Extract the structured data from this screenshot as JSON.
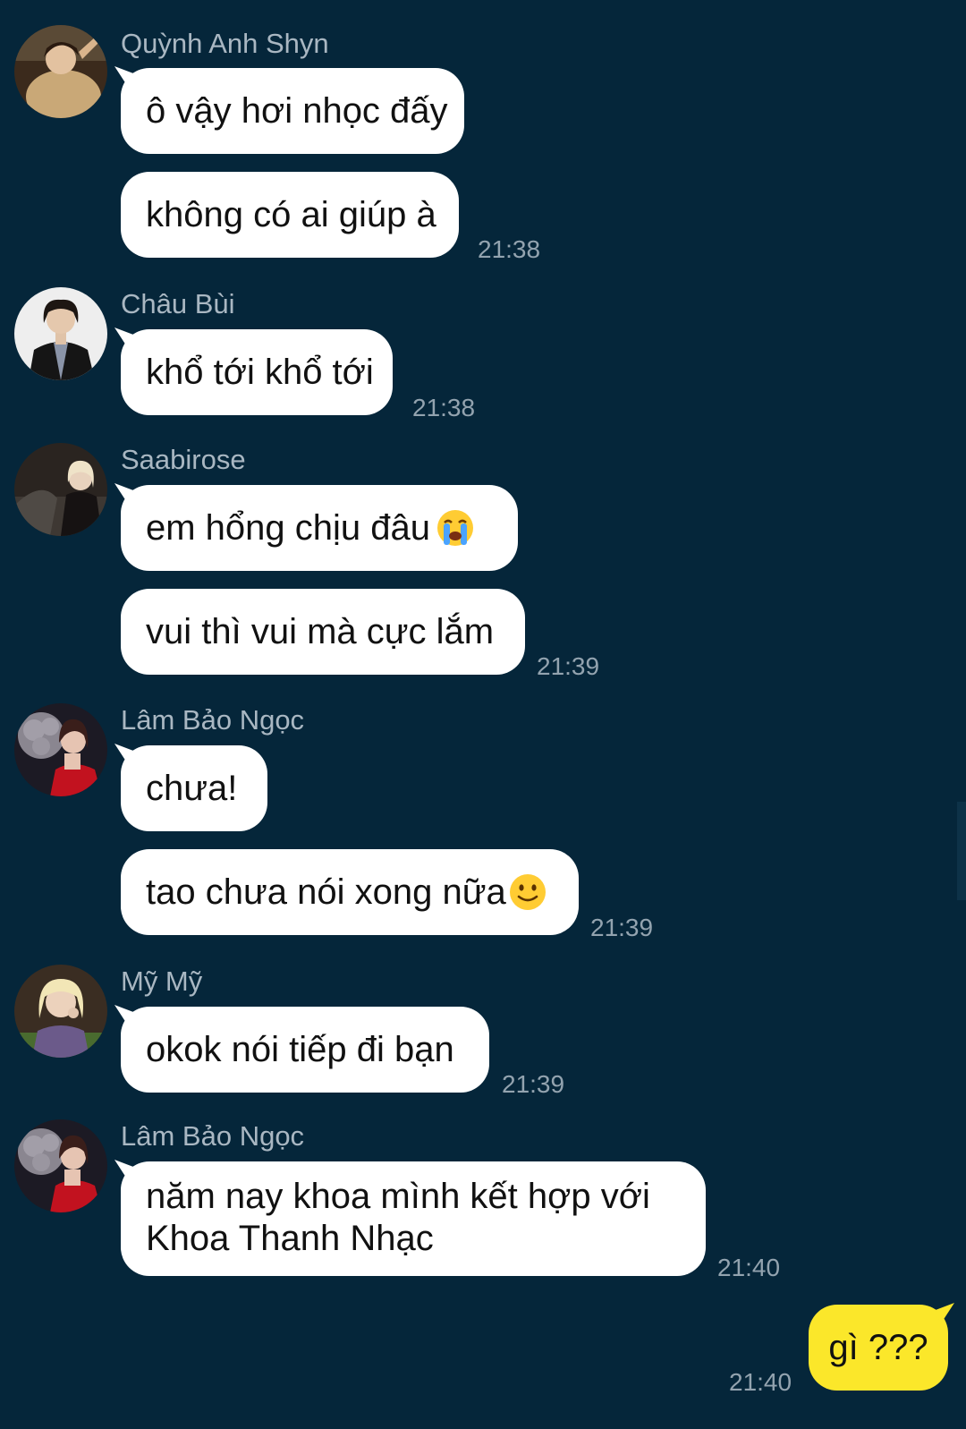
{
  "messages": [
    {
      "sender": "Quỳnh Anh Shyn",
      "avatar_icon": "avatar-quynh-anh-shyn",
      "bubbles": [
        "ô vậy hơi nhọc đấy",
        "không có ai giúp à"
      ],
      "time": "21:38"
    },
    {
      "sender": "Châu Bùi",
      "avatar_icon": "avatar-chau-bui",
      "bubbles": [
        "khổ tới khổ tới"
      ],
      "time": "21:38"
    },
    {
      "sender": "Saabirose",
      "avatar_icon": "avatar-saabirose",
      "bubbles": [
        "em hổng chịu đâu",
        "vui thì vui mà cực lắm"
      ],
      "time": "21:39"
    },
    {
      "sender": "Lâm Bảo Ngọc",
      "avatar_icon": "avatar-lam-bao-ngoc",
      "bubbles": [
        "chưa!",
        "tao chưa nói xong nữa"
      ],
      "time": "21:39"
    },
    {
      "sender": "Mỹ Mỹ",
      "avatar_icon": "avatar-my-my",
      "bubbles": [
        "okok nói tiếp đi bạn"
      ],
      "time": "21:39"
    },
    {
      "sender": "Lâm Bảo Ngọc",
      "avatar_icon": "avatar-lam-bao-ngoc",
      "bubbles": [
        "năm nay khoa mình kết hợp với Khoa Thanh Nhạc"
      ],
      "time": "21:40"
    }
  ],
  "own_message": {
    "text": "gì ???",
    "time": "21:40"
  },
  "emojis": {
    "crying": "crying-face-emoji",
    "smiling": "slightly-smiling-face-emoji"
  },
  "colors": {
    "background": "#05263a",
    "incoming_bubble": "#ffffff",
    "outgoing_bubble": "#fbe72a",
    "sender_name": "#a9b7c2",
    "timestamp": "#93a3af"
  }
}
